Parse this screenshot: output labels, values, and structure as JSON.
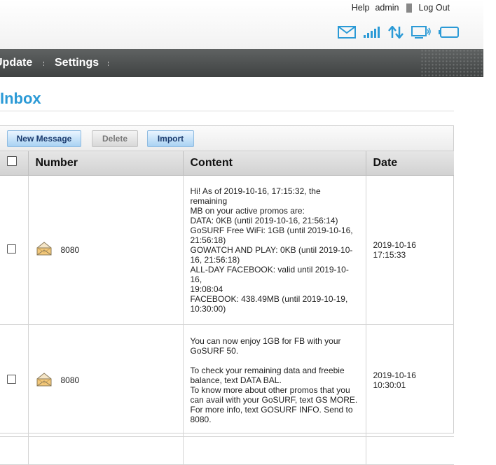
{
  "header": {
    "links": [
      "Help",
      "admin",
      "Log Out"
    ],
    "status_icons": [
      "mail-icon",
      "signal-icon",
      "data-transfer-icon",
      "connected-device-icon",
      "battery-icon"
    ],
    "accent_color": "#2b9ad6"
  },
  "nav": {
    "items": [
      "Update",
      "Settings"
    ]
  },
  "page": {
    "title": "Inbox"
  },
  "toolbar": {
    "new_message": "New Message",
    "delete": "Delete",
    "import": "Import"
  },
  "table": {
    "columns": [
      "",
      "Number",
      "Content",
      "Date"
    ],
    "rows": [
      {
        "number": "8080",
        "content": "Hi! As of 2019-10-16, 17:15:32, the remaining\nMB on your active promos are:\nDATA: 0KB (until 2019-10-16, 21:56:14)\nGoSURF Free WiFi: 1GB (until 2019-10-16,\n21:56:18)\nGOWATCH AND PLAY: 0KB (until 2019-10-\n16, 21:56:18)\nALL-DAY FACEBOOK: valid until 2019-10-16,\n19:08:04\nFACEBOOK: 438.49MB (until 2019-10-19,\n10:30:00)",
        "date": "2019-10-16 17:15:33"
      },
      {
        "number": "8080",
        "content": "You can now enjoy 1GB for FB with your\nGoSURF 50.\n\nTo check your remaining data and freebie\nbalance, text DATA BAL.\nTo know more about other promos that you\ncan avail with your GoSURF, text GS MORE.\nFor more info, text GOSURF INFO. Send to\n8080.",
        "date": "2019-10-16 10:30:01"
      }
    ]
  }
}
